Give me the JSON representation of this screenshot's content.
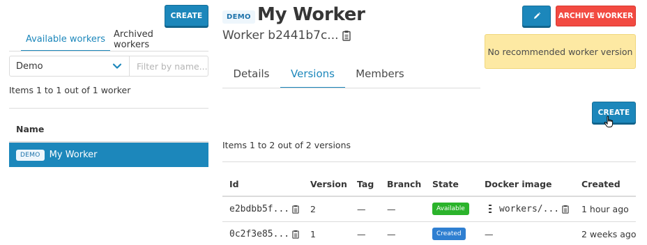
{
  "left": {
    "create_label": "CREATE",
    "tabs": [
      {
        "label": "Available workers"
      },
      {
        "label": "Archived workers"
      }
    ],
    "select_value": "Demo",
    "filter_placeholder": "Filter by name...",
    "count_text": "Items 1 to 1 out of 1 worker",
    "name_header": "Name",
    "rows": [
      {
        "tag": "DEMO",
        "label": "My Worker"
      }
    ]
  },
  "header": {
    "tag": "DEMO",
    "title": "My Worker",
    "subtitle": "Worker b2441b7c...",
    "archive_label": "ARCHIVE WORKER",
    "notice": "No recommended worker version"
  },
  "tabs": [
    {
      "label": "Details"
    },
    {
      "label": "Versions"
    },
    {
      "label": "Members"
    }
  ],
  "versions": {
    "create_label": "CREATE",
    "count_text": "Items 1 to 2 out of 2 versions",
    "columns": [
      "Id",
      "Version",
      "Tag",
      "Branch",
      "State",
      "Docker image",
      "Created"
    ],
    "rows": [
      {
        "id": "e2bdbb5f...",
        "version": "2",
        "tag": "—",
        "branch": "—",
        "state": "Available",
        "docker": "workers/...",
        "created": "1 hour ago"
      },
      {
        "id": "0c2f3e85...",
        "version": "1",
        "tag": "—",
        "branch": "—",
        "state": "Created",
        "docker": "—",
        "created": "2 weeks ago"
      }
    ]
  },
  "colors": {
    "primary": "#1c87bb",
    "danger": "#f24a41",
    "warning_bg": "#fde9a3",
    "state_available": "#2bb32b",
    "state_created": "#2f7fd1"
  }
}
